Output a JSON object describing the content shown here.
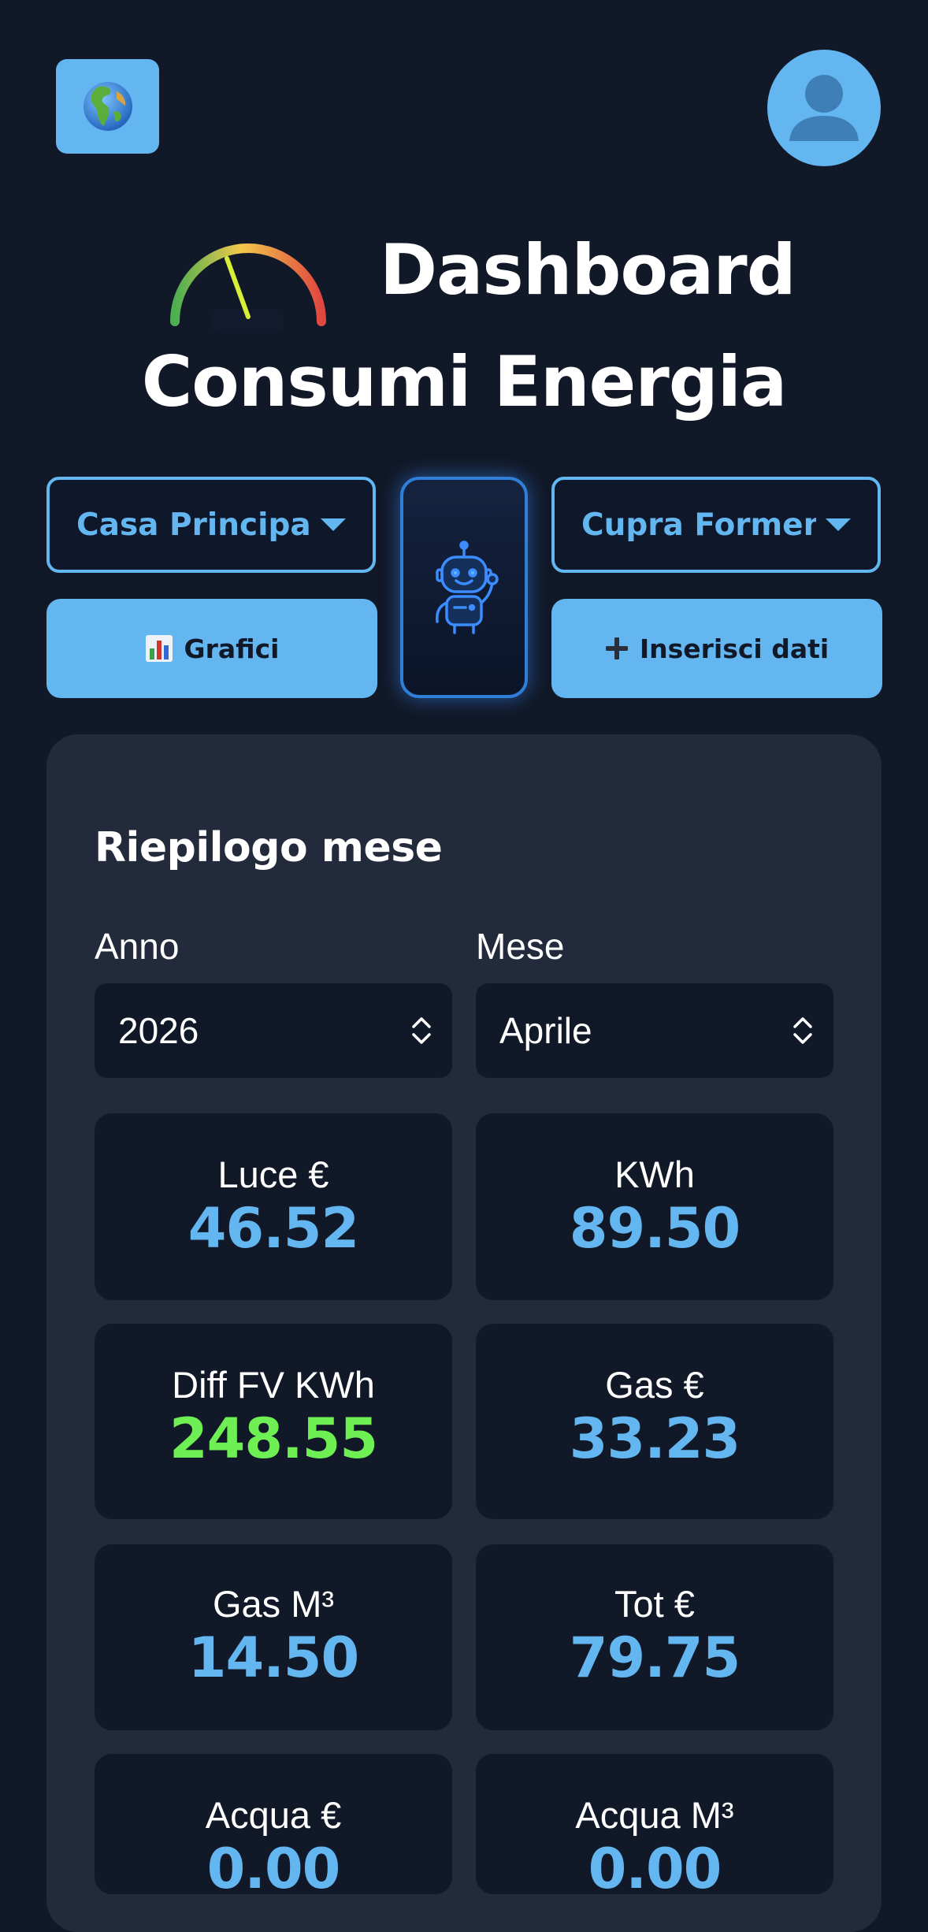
{
  "header": {
    "language_button_icon": "globe-icon",
    "profile_icon": "user-silhouette-icon",
    "title_line1": "Dashboard",
    "title_line2": "Consumi Energia",
    "title_icon": "gauge-icon"
  },
  "controls": {
    "property_select": "Casa Principale",
    "vehicle_select": "Cupra Formentor",
    "assistant_icon": "robot-icon",
    "charts_button": {
      "icon": "bar-chart-icon",
      "label": "Grafici"
    },
    "insert_button": {
      "icon": "plus-icon",
      "label": "Inserisci dati"
    }
  },
  "summary": {
    "title": "Riepilogo mese",
    "year": {
      "label": "Anno",
      "value": "2026"
    },
    "month": {
      "label": "Mese",
      "value": "Aprile"
    },
    "stats": [
      {
        "label": "Luce €",
        "value": "46.52"
      },
      {
        "label": "KWh",
        "value": "89.50"
      },
      {
        "label": "Diff FV KWh",
        "value": "248.55"
      },
      {
        "label": "Gas €",
        "value": "33.23"
      },
      {
        "label": "Gas M³",
        "value": "14.50"
      },
      {
        "label": "Tot €",
        "value": "79.75"
      },
      {
        "label": "Acqua €",
        "value": "0.00"
      },
      {
        "label": "Acqua M³",
        "value": "0.00"
      }
    ]
  },
  "colors": {
    "background": "#111827",
    "card": "#222a3b",
    "accent": "#63b6f0",
    "positive": "#6ef054"
  }
}
